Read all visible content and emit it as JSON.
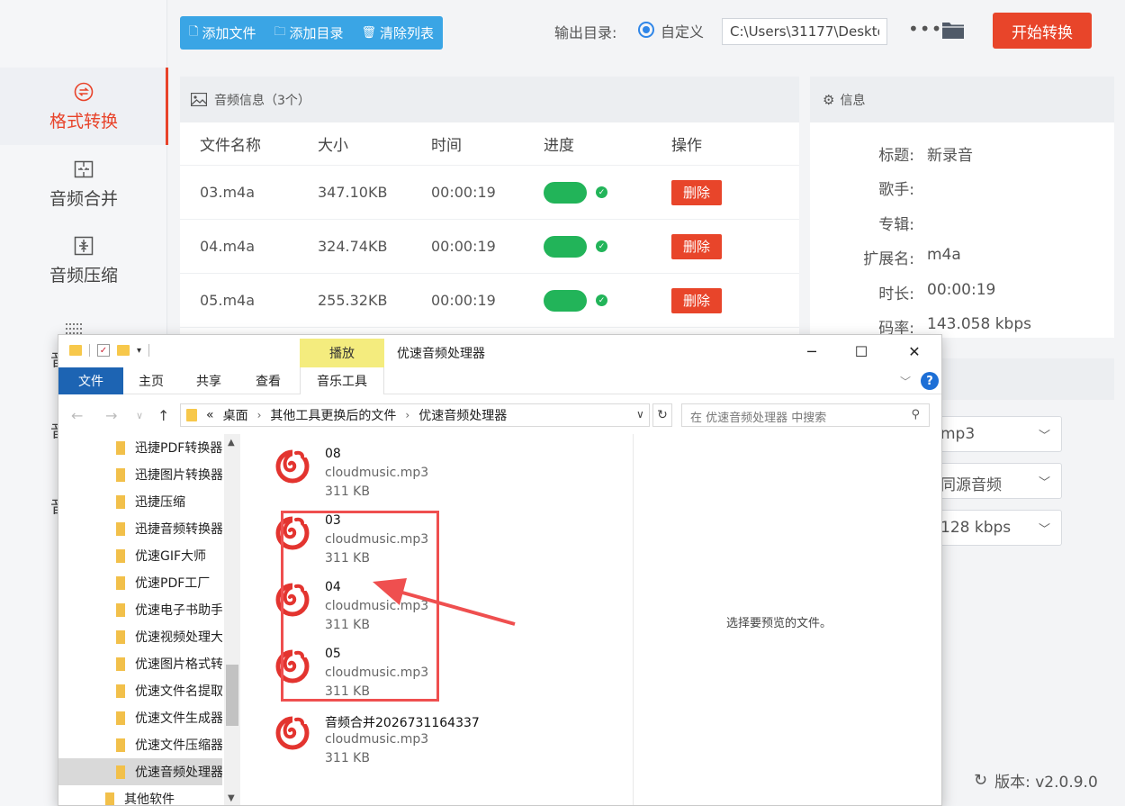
{
  "sidebar": {
    "items": [
      {
        "label": "格式转换",
        "icon": "format-convert-icon",
        "active": true
      },
      {
        "label": "音频合并",
        "icon": "merge-icon"
      },
      {
        "label": "音频压缩",
        "icon": "compress-icon"
      },
      {
        "label": "音",
        "icon": "split-icon"
      },
      {
        "label": "音"
      },
      {
        "label": "音"
      }
    ]
  },
  "toolbar": {
    "add_file": "添加文件",
    "add_dir": "添加目录",
    "clear_list": "清除列表",
    "output_label": "输出目录:",
    "radio_label": "自定义",
    "output_path": "C:\\Users\\31177\\Deskto",
    "more": "•••",
    "start": "开始转换"
  },
  "file_panel": {
    "title": "音频信息（3个）",
    "columns": [
      "文件名称",
      "大小",
      "时间",
      "进度",
      "操作"
    ],
    "rows": [
      {
        "name": "03.m4a",
        "size": "347.10KB",
        "time": "00:00:19",
        "action": "删除"
      },
      {
        "name": "04.m4a",
        "size": "324.74KB",
        "time": "00:00:19",
        "action": "删除"
      },
      {
        "name": "05.m4a",
        "size": "255.32KB",
        "time": "00:00:19",
        "action": "删除"
      }
    ]
  },
  "info_panel": {
    "title": "信息",
    "rows": [
      {
        "k": "标题:",
        "v": "新录音"
      },
      {
        "k": "歌手:",
        "v": ""
      },
      {
        "k": "专辑:",
        "v": ""
      },
      {
        "k": "扩展名:",
        "v": "m4a"
      },
      {
        "k": "时长:",
        "v": "00:00:19"
      },
      {
        "k": "码率:",
        "v": "143.058 kbps"
      }
    ]
  },
  "settings": {
    "format": "mp3",
    "source": "同源音频",
    "bitrate": "128 kbps"
  },
  "version": "版本: v2.0.9.0",
  "explorer": {
    "context_tab": "播放",
    "title": "优速音频处理器",
    "ribbon_tabs": [
      "文件",
      "主页",
      "共享",
      "查看",
      "音乐工具"
    ],
    "breadcrumb": [
      "桌面",
      "其他工具更换后的文件",
      "优速音频处理器"
    ],
    "breadcrumb_prefix": "«",
    "search_placeholder": "在 优速音频处理器 中搜索",
    "tree": [
      "迅捷PDF转换器",
      "迅捷图片转换器",
      "迅捷压缩",
      "迅捷音频转换器",
      "优速GIF大师",
      "优速PDF工厂",
      "优速电子书助手",
      "优速视频处理大师",
      "优速图片格式转换器",
      "优速文件名提取器",
      "优速文件生成器",
      "优速文件压缩器",
      "优速音频处理器",
      "其他软件"
    ],
    "selected_tree_index": 12,
    "files": [
      {
        "name": "08",
        "type": "cloudmusic.mp3",
        "size": "311 KB"
      },
      {
        "name": "03",
        "type": "cloudmusic.mp3",
        "size": "311 KB"
      },
      {
        "name": "04",
        "type": "cloudmusic.mp3",
        "size": "311 KB"
      },
      {
        "name": "05",
        "type": "cloudmusic.mp3",
        "size": "311 KB"
      },
      {
        "name": "音频合并2026731164337",
        "type": "cloudmusic.mp3",
        "size": "311 KB"
      }
    ],
    "preview_text": "选择要预览的文件。"
  },
  "colors": {
    "accent_red": "#e8452a",
    "toolbar_blue": "#3aa5e5",
    "progress_green": "#22b459",
    "annotation_red": "#ef4f4f",
    "netease_red": "#e3342f"
  }
}
